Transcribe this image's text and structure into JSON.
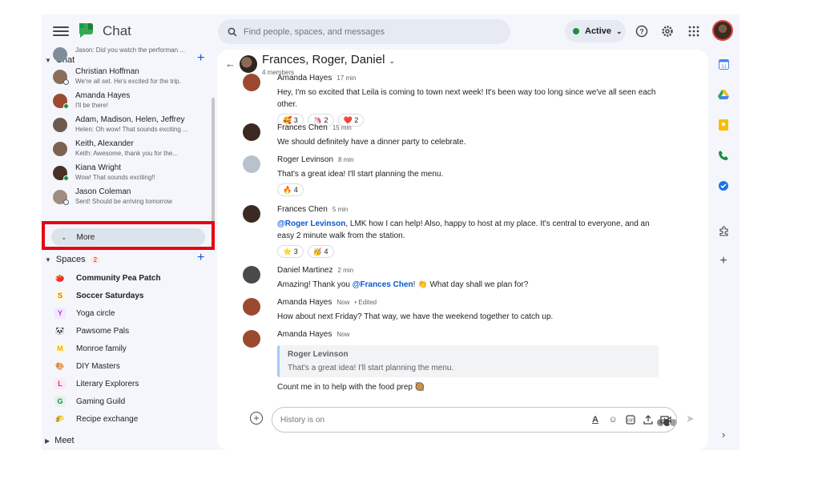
{
  "header": {
    "app_title": "Chat",
    "search_placeholder": "Find people, spaces, and messages",
    "status": "Active"
  },
  "sidebar": {
    "chat_heading": "Chat",
    "dms": [
      {
        "name": "",
        "preview": "Jason: Did you watch the performan ...",
        "avatar_color": "#7f8c9a"
      },
      {
        "name": "Christian Hoffman",
        "preview": "We're all set.  He's excited for the trip.",
        "avatar_color": "#8a6d5a",
        "presence": "away"
      },
      {
        "name": "Amanda Hayes",
        "preview": "I'll be there!",
        "avatar_color": "#9b4a2f",
        "presence": "active"
      },
      {
        "name": "Adam, Madison, Helen, Jeffrey",
        "preview": "Helen: Oh wow! That sounds exciting ...",
        "avatar_color": "#6b5a4e"
      },
      {
        "name": "Keith, Alexander",
        "preview": "Keith: Awesome, thank you for the...",
        "avatar_color": "#7a6352"
      },
      {
        "name": "Kiana Wright",
        "preview": "Wow!  That sounds exciting!!",
        "avatar_color": "#4b3026",
        "presence": "active"
      },
      {
        "name": "Jason Coleman",
        "preview": "Sent! Should be arriving tomorrow",
        "avatar_color": "#a08c80",
        "presence": "away"
      }
    ],
    "more_label": "More",
    "spaces_heading": "Spaces",
    "spaces_badge": "2",
    "spaces": [
      {
        "name": "Community Pea Patch",
        "icon": "🍅",
        "bold": true,
        "bg": "transparent",
        "fg": "#c5221f"
      },
      {
        "name": "Soccer Saturdays",
        "icon": "S",
        "bold": true,
        "bg": "#fef7e0",
        "fg": "#e37400"
      },
      {
        "name": "Yoga circle",
        "icon": "Y",
        "bold": false,
        "bg": "#f3e8fd",
        "fg": "#a142f4"
      },
      {
        "name": "Pawsome Pals",
        "icon": "🐼",
        "bold": false,
        "bg": "transparent",
        "fg": "#1f1f1f"
      },
      {
        "name": "Monroe family",
        "icon": "M",
        "bold": false,
        "bg": "#fef7e0",
        "fg": "#f9ab00"
      },
      {
        "name": "DIY Masters",
        "icon": "🎨",
        "bold": false,
        "bg": "transparent",
        "fg": "#1f1f1f"
      },
      {
        "name": "Literary Explorers",
        "icon": "L",
        "bold": false,
        "bg": "#fce8f3",
        "fg": "#e52592"
      },
      {
        "name": "Gaming Guild",
        "icon": "G",
        "bold": false,
        "bg": "#e6f4ea",
        "fg": "#1e8e3e"
      },
      {
        "name": "Recipe exchange",
        "icon": "🌮",
        "bold": false,
        "bg": "transparent",
        "fg": "#1f1f1f"
      }
    ],
    "meet_heading": "Meet"
  },
  "conversation": {
    "title": "Frances, Roger, Daniel",
    "members": "4 members",
    "messages": [
      {
        "sender": "Amanda Hayes",
        "time": "17 min",
        "text": "Hey, I'm so excited that Leila is coming to town next week! It's been way too long since we've all seen each other.",
        "reactions": [
          {
            "emoji": "🥰",
            "count": "3"
          },
          {
            "emoji": "🦄",
            "count": "2"
          },
          {
            "emoji": "❤️",
            "count": "2"
          }
        ],
        "avatar_color": "#9b4a2f"
      },
      {
        "sender": "Frances Chen",
        "time": "15 min",
        "text": "We should definitely have a dinner party to celebrate.",
        "reactions": [],
        "avatar_color": "#3b2a22"
      },
      {
        "sender": "Roger Levinson",
        "time": "8 min",
        "text": "That's a great idea! I'll start planning the menu.",
        "reactions": [
          {
            "emoji": "🔥",
            "count": "4"
          }
        ],
        "avatar_color": "#b9c2cc"
      },
      {
        "sender": "Frances Chen",
        "time": "5 min",
        "mention": "@Roger Levinson",
        "text": ", LMK how I can help!  Also, happy to host at my place. It's central to everyone, and an easy 2 minute walk from the station.",
        "reactions": [
          {
            "emoji": "⭐",
            "count": "3"
          },
          {
            "emoji": "🥳",
            "count": "4"
          }
        ],
        "avatar_color": "#3b2a22"
      },
      {
        "sender": "Daniel Martinez",
        "time": "2 min",
        "text_before": "Amazing! Thank you ",
        "mention": "@Frances Chen",
        "text": "! 👏 What day shall we plan for?",
        "reactions": [],
        "avatar_color": "#4a4a4a"
      },
      {
        "sender": "Amanda Hayes",
        "time": "Now",
        "edited": "Edited",
        "text": "How about next Friday? That way, we have the weekend together to catch up.",
        "reactions": [],
        "avatar_color": "#9b4a2f"
      },
      {
        "sender": "Amanda Hayes",
        "time": "Now",
        "quote_name": "Roger Levinson",
        "quote_text": "That's a great idea! I'll start planning the menu.",
        "text": "Count me in to help with the food prep 🥘",
        "reactions": [],
        "avatar_color": "#9b4a2f"
      }
    ],
    "composer_placeholder": "History is on"
  },
  "colors": {
    "accent": "#0b57d0",
    "active": "#1e8e3e",
    "highlight_box": "#e30613"
  },
  "icons": [
    "menu-icon",
    "chat-logo-icon",
    "search-icon",
    "help-icon",
    "settings-icon",
    "apps-icon",
    "back-arrow-icon",
    "add-icon",
    "format-text-icon",
    "emoji-icon",
    "gif-icon",
    "upload-icon",
    "video-add-icon",
    "send-icon",
    "calendar-icon",
    "drive-icon",
    "keep-icon",
    "voice-icon",
    "tasks-icon",
    "addons-icon",
    "plus-icon",
    "expand-panel-icon"
  ]
}
